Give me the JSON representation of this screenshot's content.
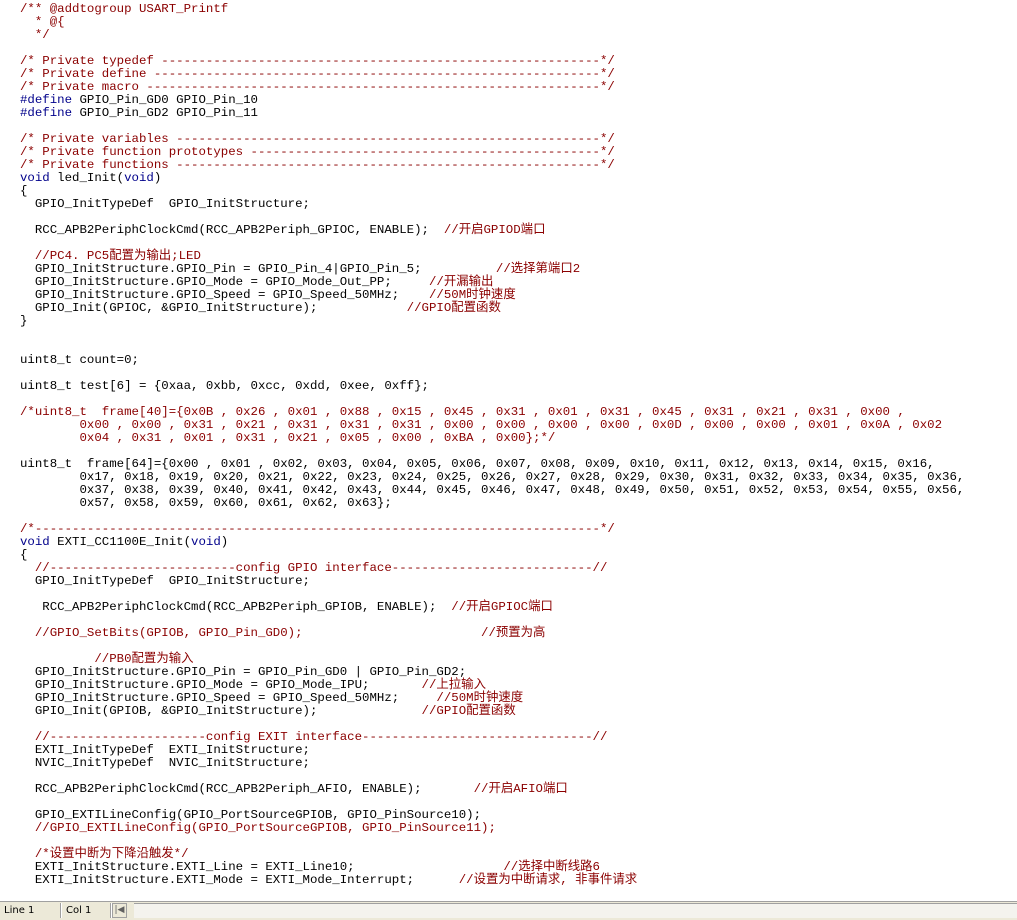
{
  "editor": {
    "lines": [
      {
        "kind": "comment",
        "text": "/** @addtogroup USART_Printf"
      },
      {
        "kind": "comment",
        "text": "  * @{"
      },
      {
        "kind": "comment",
        "text": "  */"
      },
      {
        "kind": "blank",
        "text": ""
      },
      {
        "kind": "comment",
        "text": "/* Private typedef -----------------------------------------------------------*/"
      },
      {
        "kind": "comment",
        "text": "/* Private define ------------------------------------------------------------*/"
      },
      {
        "kind": "comment",
        "text": "/* Private macro -------------------------------------------------------------*/"
      },
      {
        "kind": "code",
        "pre": "#define",
        "text": " GPIO_Pin_GD0 GPIO_Pin_10"
      },
      {
        "kind": "code",
        "pre": "#define",
        "text": " GPIO_Pin_GD2 GPIO_Pin_11"
      },
      {
        "kind": "blank",
        "text": ""
      },
      {
        "kind": "comment",
        "text": "/* Private variables ---------------------------------------------------------*/"
      },
      {
        "kind": "comment",
        "text": "/* Private function prototypes -----------------------------------------------*/"
      },
      {
        "kind": "comment",
        "text": "/* Private functions ---------------------------------------------------------*/"
      },
      {
        "kind": "code",
        "pre": "void",
        "text": " led_Init(",
        "post_kw": "void",
        "post": ")"
      },
      {
        "kind": "code",
        "text": "{"
      },
      {
        "kind": "code",
        "text": "  GPIO_InitTypeDef  GPIO_InitStructure;"
      },
      {
        "kind": "blank",
        "text": ""
      },
      {
        "kind": "code",
        "text": "  RCC_APB2PeriphClockCmd(RCC_APB2Periph_GPIOC, ENABLE);  ",
        "comment": "//开启GPIOD端口"
      },
      {
        "kind": "blank",
        "text": ""
      },
      {
        "kind": "comment",
        "text": "  //PC4. PC5配置为输出;LED"
      },
      {
        "kind": "code",
        "text": "  GPIO_InitStructure.GPIO_Pin = GPIO_Pin_4|GPIO_Pin_5;          ",
        "comment": "//选择第端口2"
      },
      {
        "kind": "code",
        "text": "  GPIO_InitStructure.GPIO_Mode = GPIO_Mode_Out_PP;     ",
        "comment": "//开漏输出"
      },
      {
        "kind": "code",
        "text": "  GPIO_InitStructure.GPIO_Speed = GPIO_Speed_50MHz;    ",
        "comment": "//50M时钟速度"
      },
      {
        "kind": "code",
        "text": "  GPIO_Init(GPIOC, &GPIO_InitStructure);            ",
        "comment": "//GPIO配置函数"
      },
      {
        "kind": "code",
        "text": "}"
      },
      {
        "kind": "blank",
        "text": ""
      },
      {
        "kind": "blank",
        "text": ""
      },
      {
        "kind": "code",
        "text": "uint8_t count=0;"
      },
      {
        "kind": "blank",
        "text": ""
      },
      {
        "kind": "code",
        "text": "uint8_t test[6] = {0xaa, 0xbb, 0xcc, 0xdd, 0xee, 0xff};"
      },
      {
        "kind": "blank",
        "text": ""
      },
      {
        "kind": "comment",
        "text": "/*uint8_t  frame[40]={0x0B , 0x26 , 0x01 , 0x88 , 0x15 , 0x45 , 0x31 , 0x01 , 0x31 , 0x45 , 0x31 , 0x21 , 0x31 , 0x00 ,"
      },
      {
        "kind": "comment",
        "text": "        0x00 , 0x00 , 0x31 , 0x21 , 0x31 , 0x31 , 0x31 , 0x00 , 0x00 , 0x00 , 0x00 , 0x0D , 0x00 , 0x00 , 0x01 , 0x0A , 0x02"
      },
      {
        "kind": "comment",
        "text": "        0x04 , 0x31 , 0x01 , 0x31 , 0x21 , 0x05 , 0x00 , 0xBA , 0x00};*/"
      },
      {
        "kind": "blank",
        "text": ""
      },
      {
        "kind": "code",
        "text": "uint8_t  frame[64]={0x00 , 0x01 , 0x02, 0x03, 0x04, 0x05, 0x06, 0x07, 0x08, 0x09, 0x10, 0x11, 0x12, 0x13, 0x14, 0x15, 0x16,"
      },
      {
        "kind": "code",
        "text": "        0x17, 0x18, 0x19, 0x20, 0x21, 0x22, 0x23, 0x24, 0x25, 0x26, 0x27, 0x28, 0x29, 0x30, 0x31, 0x32, 0x33, 0x34, 0x35, 0x36,"
      },
      {
        "kind": "code",
        "text": "        0x37, 0x38, 0x39, 0x40, 0x41, 0x42, 0x43, 0x44, 0x45, 0x46, 0x47, 0x48, 0x49, 0x50, 0x51, 0x52, 0x53, 0x54, 0x55, 0x56,"
      },
      {
        "kind": "code",
        "text": "        0x57, 0x58, 0x59, 0x60, 0x61, 0x62, 0x63};"
      },
      {
        "kind": "blank",
        "text": ""
      },
      {
        "kind": "comment",
        "text": "/*----------------------------------------------------------------------------*/"
      },
      {
        "kind": "code",
        "pre": "void",
        "text": " EXTI_CC1100E_Init(",
        "post_kw": "void",
        "post": ")"
      },
      {
        "kind": "code",
        "text": "{"
      },
      {
        "kind": "comment",
        "text": "  //-------------------------config GPIO interface---------------------------//"
      },
      {
        "kind": "code",
        "text": "  GPIO_InitTypeDef  GPIO_InitStructure;"
      },
      {
        "kind": "blank",
        "text": ""
      },
      {
        "kind": "code",
        "text": "   RCC_APB2PeriphClockCmd(RCC_APB2Periph_GPIOB, ENABLE);  ",
        "comment": "//开启GPIOC端口"
      },
      {
        "kind": "blank",
        "text": ""
      },
      {
        "kind": "comment",
        "text": "  //GPIO_SetBits(GPIOB, GPIO_Pin_GD0);                        //预置为高"
      },
      {
        "kind": "blank",
        "text": ""
      },
      {
        "kind": "comment",
        "text": "          //PB0配置为输入"
      },
      {
        "kind": "code",
        "text": "  GPIO_InitStructure.GPIO_Pin = GPIO_Pin_GD0 | GPIO_Pin_GD2;"
      },
      {
        "kind": "code",
        "text": "  GPIO_InitStructure.GPIO_Mode = GPIO_Mode_IPU;       ",
        "comment": "//上拉输入"
      },
      {
        "kind": "code",
        "text": "  GPIO_InitStructure.GPIO_Speed = GPIO_Speed_50MHz;     ",
        "comment": "//50M时钟速度"
      },
      {
        "kind": "code",
        "text": "  GPIO_Init(GPIOB, &GPIO_InitStructure);              ",
        "comment": "//GPIO配置函数"
      },
      {
        "kind": "blank",
        "text": ""
      },
      {
        "kind": "comment",
        "text": "  //---------------------config EXIT interface-------------------------------//"
      },
      {
        "kind": "code",
        "text": "  EXTI_InitTypeDef  EXTI_InitStructure;"
      },
      {
        "kind": "code",
        "text": "  NVIC_InitTypeDef  NVIC_InitStructure;"
      },
      {
        "kind": "blank",
        "text": ""
      },
      {
        "kind": "code",
        "text": "  RCC_APB2PeriphClockCmd(RCC_APB2Periph_AFIO, ENABLE);       ",
        "comment": "//开启AFIO端口"
      },
      {
        "kind": "blank",
        "text": ""
      },
      {
        "kind": "code",
        "text": "  GPIO_EXTILineConfig(GPIO_PortSourceGPIOB, GPIO_PinSource10);"
      },
      {
        "kind": "comment",
        "text": "  //GPIO_EXTILineConfig(GPIO_PortSourceGPIOB, GPIO_PinSource11);"
      },
      {
        "kind": "blank",
        "text": ""
      },
      {
        "kind": "comment",
        "text": "  /*设置中断为下降沿触发*/"
      },
      {
        "kind": "code",
        "text": "  EXTI_InitStructure.EXTI_Line = EXTI_Line10;                    ",
        "comment": "//选择中断线路6"
      },
      {
        "kind": "code",
        "text": "  EXTI_InitStructure.EXTI_Mode = EXTI_Mode_Interrupt;      ",
        "comment": "//设置为中断请求, 非事件请求"
      }
    ]
  },
  "statusbar": {
    "line_label": "Line 1",
    "col_label": "Col 1",
    "nav_first": "|◀",
    "nav_prev": "◀"
  },
  "colors": {
    "comment": "#8b0000",
    "keyword": "#00008b",
    "text": "#000000"
  }
}
